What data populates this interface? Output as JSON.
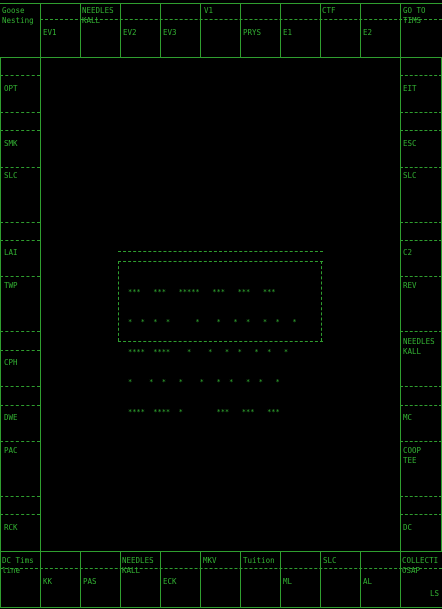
{
  "theme": {
    "background": "#000000",
    "text": "#33b233",
    "lines": "#2f9e2f"
  },
  "top_bar": {
    "row1": [
      "Goose",
      "",
      "NEEDLES",
      "",
      "",
      "V1",
      "",
      "",
      "CTF",
      "",
      "GO TO"
    ],
    "row2": [
      "Nesting",
      "",
      "KALL",
      "",
      "",
      "",
      "",
      "",
      "",
      "",
      "TIMS"
    ],
    "row3": [
      "",
      "EV1",
      "",
      "EV2",
      "EV3",
      "",
      "PRYS",
      "E1",
      "",
      "E2",
      ""
    ]
  },
  "left_column": [
    "OPT",
    "SMK",
    "SLC",
    "LAI",
    "TWP",
    "CPH",
    "DWE",
    "PAC",
    "RCK"
  ],
  "right_column": [
    "EIT",
    "ESC",
    "SLC",
    "C2",
    "REV",
    "NEEDLES",
    "KALL",
    "MC",
    "COOP",
    "TEE",
    "DC"
  ],
  "bottom_bar": {
    "row1": [
      "DC Tims",
      "",
      "",
      "NEEDLES",
      "",
      "MKV",
      "Tuition",
      "",
      "SLC",
      "",
      "COLLECTI"
    ],
    "row2": [
      "line",
      "",
      "",
      "KALL",
      "",
      "",
      "",
      "",
      "",
      "",
      "OSAP"
    ],
    "row3": [
      "",
      "KK",
      "PAS",
      "",
      "ECK",
      "",
      "",
      "ML",
      "",
      "AL",
      "LS"
    ]
  },
  "center_logo": {
    "art": [
      "***   ***   *****   ***   ***   ***",
      "*  *  *  *      *    *   *  *   *  *   *",
      "****  ****    *    *   *  *   *  *   *",
      "*    *  *   *    *   *  *   *  *   *",
      "****  ****  *        ***   ***   ***"
    ]
  }
}
